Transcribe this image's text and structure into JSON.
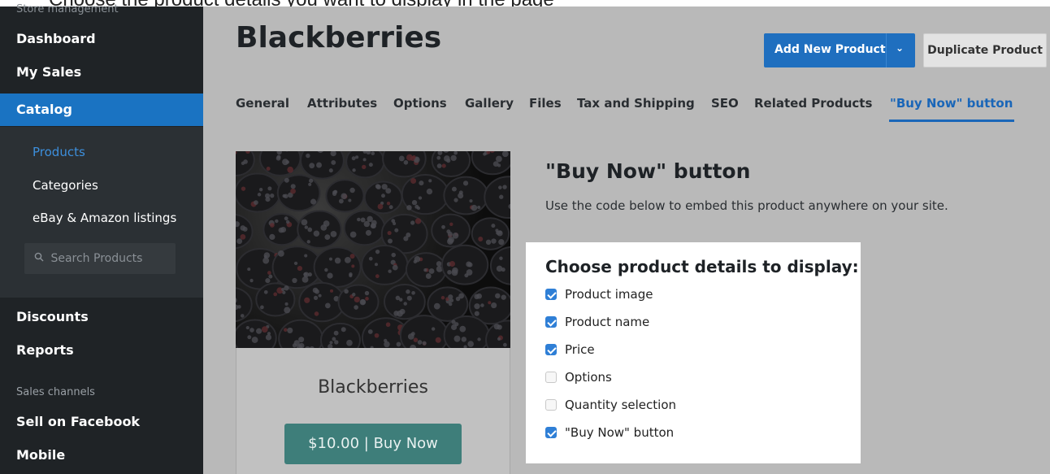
{
  "caption": "Choose the product details you want to display in the page",
  "sidebar": {
    "header": "Store management",
    "top_items": [
      {
        "label": "Dashboard"
      },
      {
        "label": "My Sales"
      },
      {
        "label": "Catalog"
      }
    ],
    "catalog_sub": [
      {
        "label": "Products"
      },
      {
        "label": "Categories"
      },
      {
        "label": "eBay & Amazon listings"
      }
    ],
    "search_placeholder": "Search Products",
    "mid_items": [
      {
        "label": "Discounts"
      },
      {
        "label": "Reports"
      }
    ],
    "section_label": "Sales channels",
    "bottom_items": [
      {
        "label": "Sell on Facebook"
      },
      {
        "label": "Mobile"
      }
    ]
  },
  "header": {
    "title": "Blackberries",
    "add_button": "Add New Product",
    "duplicate_button": "Duplicate Product"
  },
  "tabs": [
    {
      "label": "General"
    },
    {
      "label": "Attributes"
    },
    {
      "label": "Options"
    },
    {
      "label": "Gallery"
    },
    {
      "label": "Files"
    },
    {
      "label": "Tax and Shipping"
    },
    {
      "label": "SEO"
    },
    {
      "label": "Related Products"
    },
    {
      "label": "\"Buy Now\" button"
    }
  ],
  "active_tab": "\"Buy Now\" button",
  "preview": {
    "name": "Blackberries",
    "buy_label": "$10.00 | Buy Now"
  },
  "buy_now": {
    "title": "\"Buy Now\" button",
    "description": "Use the code below to embed this product anywhere on your site.",
    "panel_title": "Choose product details to display:",
    "options": [
      {
        "label": "Product image",
        "checked": true
      },
      {
        "label": "Product name",
        "checked": true
      },
      {
        "label": "Price",
        "checked": true
      },
      {
        "label": "Options",
        "checked": false
      },
      {
        "label": "Quantity selection",
        "checked": false
      },
      {
        "label": "\"Buy Now\" button",
        "checked": true
      }
    ]
  },
  "colors": {
    "sidebar_bg": "#1f2326",
    "accent": "#1a73c2",
    "buy_button": "#3e7e7a"
  }
}
